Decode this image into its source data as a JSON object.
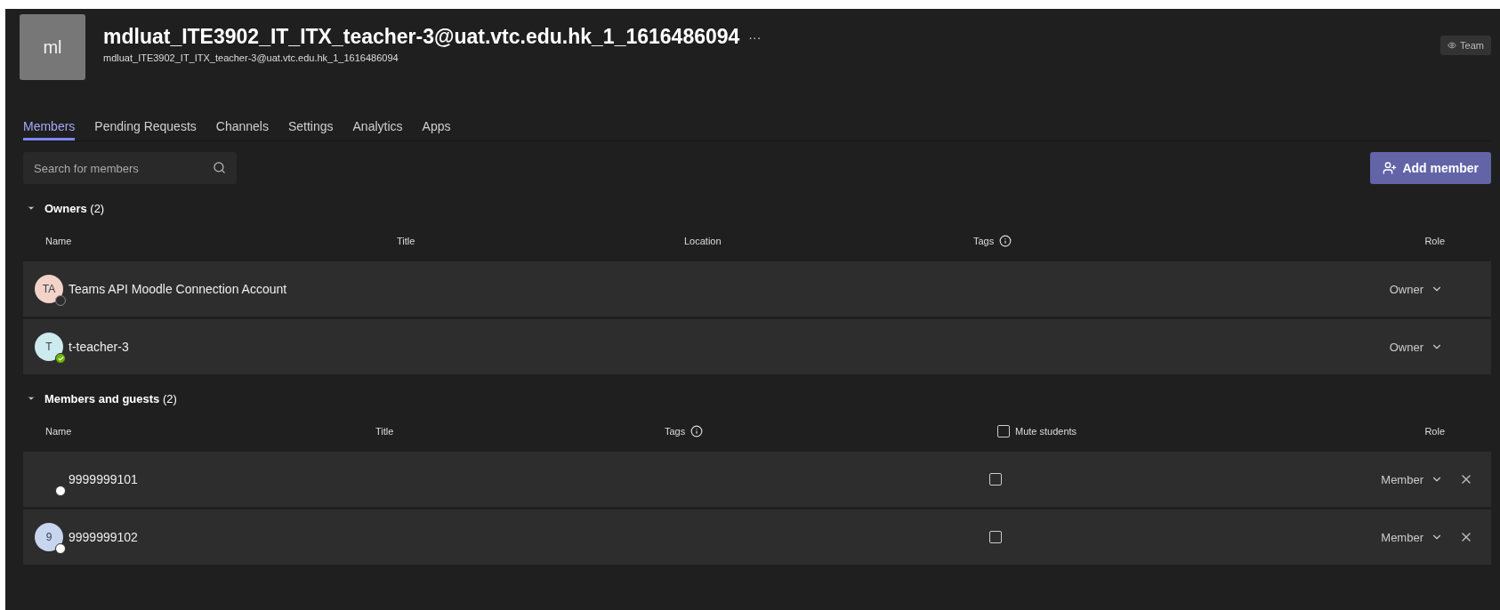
{
  "team": {
    "initials": "ml",
    "name": "mdluat_ITE3902_IT_ITX_teacher-3@uat.vtc.edu.hk_1_1616486094",
    "more": "···",
    "description": "mdluat_ITE3902_IT_ITX_teacher-3@uat.vtc.edu.hk_1_1616486094",
    "badge": "Team"
  },
  "tabs": [
    {
      "label": "Members",
      "selected": true
    },
    {
      "label": "Pending Requests",
      "selected": false
    },
    {
      "label": "Channels",
      "selected": false
    },
    {
      "label": "Settings",
      "selected": false
    },
    {
      "label": "Analytics",
      "selected": false
    },
    {
      "label": "Apps",
      "selected": false
    }
  ],
  "search": {
    "placeholder": "Search for members"
  },
  "add_button": "Add member",
  "sections": [
    {
      "title": "Owners",
      "count": "(2)",
      "expanded": true,
      "kind": "owners",
      "columns": [
        "Name",
        "Title",
        "Location",
        "Tags",
        "Role"
      ],
      "rows": [
        {
          "initials": "TA",
          "color": "#f3d2c8",
          "kind": "offline",
          "name": "Teams API Moodle Connection Account",
          "role": "Owner",
          "removable": false
        },
        {
          "initials": "T",
          "color": "#cdeaee",
          "kind": "available",
          "name": "t-teacher-3",
          "role": "Owner",
          "removable": false
        }
      ]
    },
    {
      "title": "Members and guests",
      "count": "(2)",
      "expanded": true,
      "kind": "members",
      "columns": [
        "Name",
        "Title",
        "Tags",
        "Mute students",
        "Role"
      ],
      "mute_all": false,
      "rows": [
        {
          "kind": "unknown",
          "name": "9999999101",
          "role": "Member",
          "removable": true,
          "muted": false
        },
        {
          "initials": "9",
          "color": "#c8d5ee",
          "kind": "unknown",
          "name": "9999999102",
          "role": "Member",
          "removable": true,
          "muted": false
        }
      ]
    }
  ]
}
